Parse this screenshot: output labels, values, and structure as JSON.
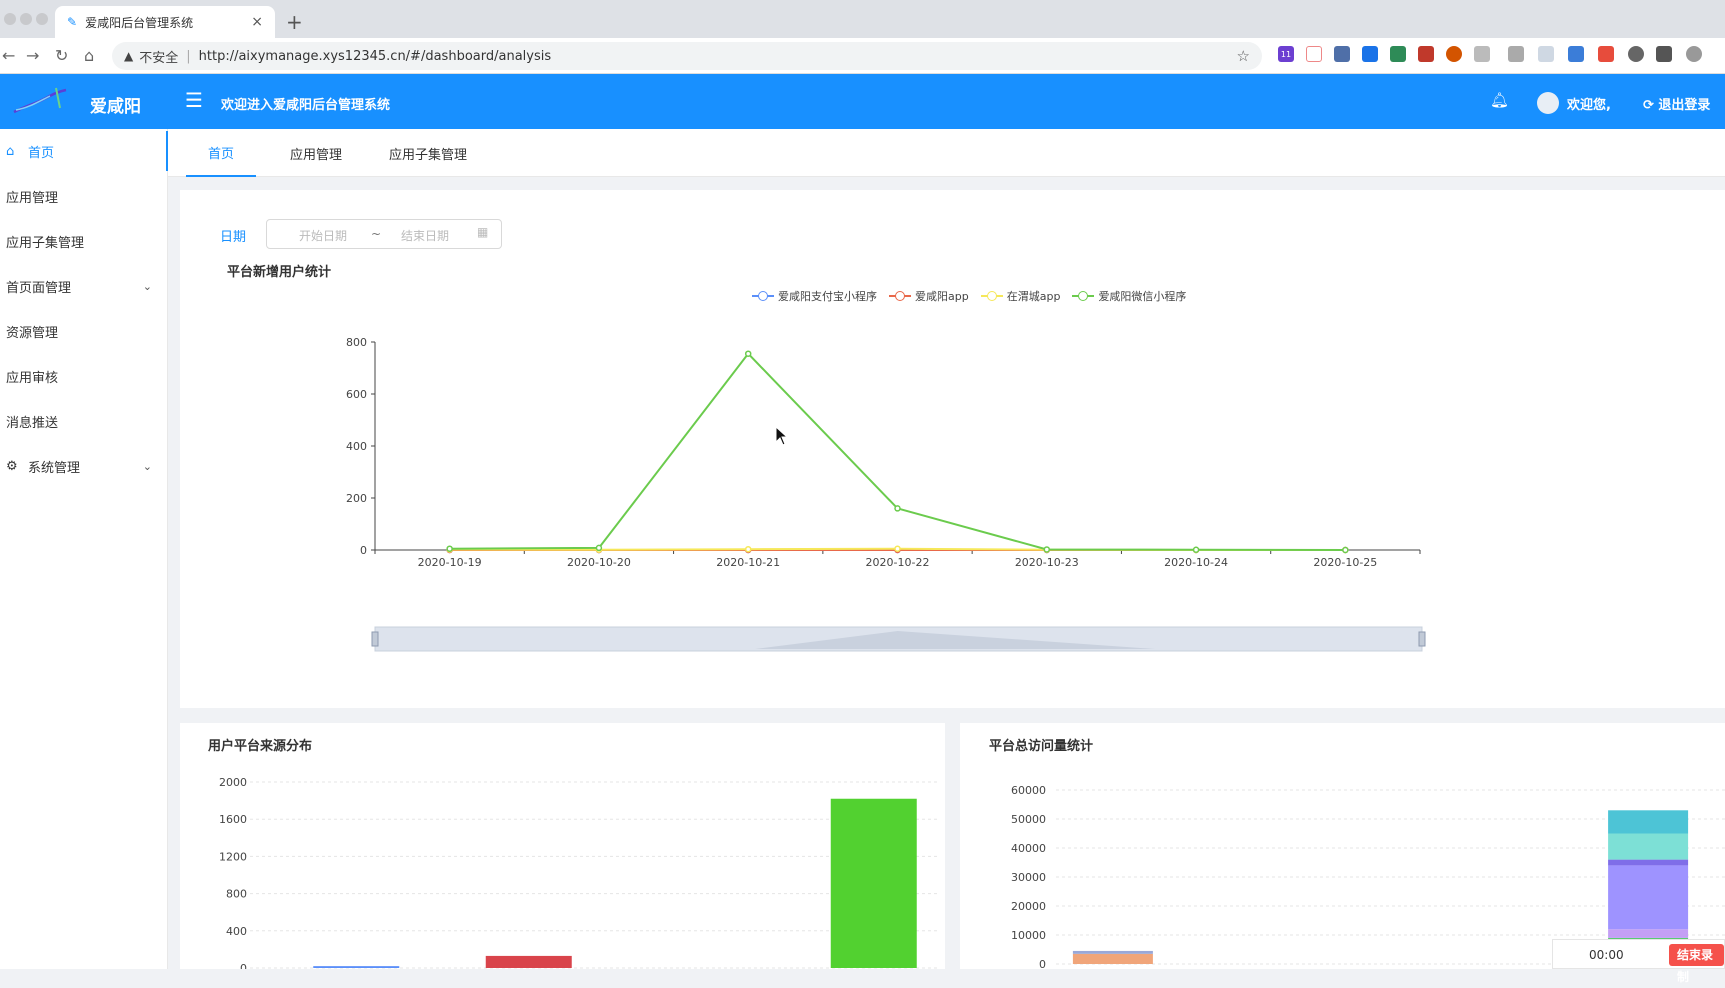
{
  "browser": {
    "tab_title": "爱咸阳后台管理系统",
    "close_glyph": "×",
    "new_tab_glyph": "+",
    "insecure_label": "不安全",
    "url": "http://aixymanage.xys12345.cn/#/dashboard/analysis",
    "ext_badge": "11"
  },
  "header": {
    "logo_text": "爱咸阳",
    "welcome_text": "欢迎进入爱咸阳后台管理系统",
    "user_greeting": "欢迎您,",
    "logout_label": "退出登录"
  },
  "sidebar": {
    "items": [
      {
        "label": "首页",
        "icon": "home-icon"
      },
      {
        "label": "应用管理"
      },
      {
        "label": "应用子集管理"
      },
      {
        "label": "首页面管理",
        "icon": "chevron-down-icon"
      },
      {
        "label": "资源管理"
      },
      {
        "label": "应用审核"
      },
      {
        "label": "消息推送"
      },
      {
        "label": "系统管理",
        "icon": "gear-icon"
      }
    ]
  },
  "tabs": [
    {
      "label": "首页"
    },
    {
      "label": "应用管理"
    },
    {
      "label": "应用子集管理"
    }
  ],
  "filter": {
    "date_label": "日期",
    "start_placeholder": "开始日期",
    "range_separator": "~",
    "end_placeholder": "结束日期"
  },
  "recorder": {
    "time": "00:00",
    "stop_label": "结束录制"
  },
  "chart_data": [
    {
      "type": "line",
      "title": "平台新增用户统计",
      "x": [
        "2020-10-19",
        "2020-10-20",
        "2020-10-21",
        "2020-10-22",
        "2020-10-23",
        "2020-10-24",
        "2020-10-25"
      ],
      "ylim": [
        0,
        800
      ],
      "yticks": [
        0,
        200,
        400,
        600,
        800
      ],
      "legend_position": "top-center",
      "series": [
        {
          "name": "爱咸阳支付宝小程序",
          "color": "#5b8ff9",
          "values": [
            0,
            0,
            0,
            0,
            0,
            0,
            0
          ]
        },
        {
          "name": "爱咸阳app",
          "color": "#e8684a",
          "values": [
            0,
            0,
            0,
            0,
            0,
            0,
            0
          ]
        },
        {
          "name": "在渭城app",
          "color": "#f6e85a",
          "values": [
            2,
            1,
            3,
            5,
            1,
            0,
            0
          ]
        },
        {
          "name": "爱咸阳微信小程序",
          "color": "#6bcb4d",
          "values": [
            5,
            8,
            755,
            160,
            2,
            1,
            0
          ]
        }
      ]
    },
    {
      "type": "bar",
      "title": "用户平台来源分布",
      "ylim": [
        0,
        2000
      ],
      "yticks": [
        0,
        400,
        800,
        1200,
        1600,
        2000
      ],
      "values": [
        20,
        130,
        0,
        1820
      ],
      "colors": [
        "#5b8ff9",
        "#d9444b",
        "#f6e85a",
        "#52d130"
      ],
      "grid": true
    },
    {
      "type": "bar",
      "title": "平台总访问量统计",
      "ylim": [
        0,
        60000
      ],
      "yticks": [
        0,
        10000,
        20000,
        30000,
        40000,
        50000,
        60000
      ],
      "stacked": true,
      "grid": true,
      "stacks": [
        [
          {
            "value": 3500,
            "color": "#f0a57a"
          },
          {
            "value": 1000,
            "color": "#9aa8d8"
          }
        ],
        [],
        [],
        [],
        [
          {
            "value": 9000,
            "color": "#5ac972"
          },
          {
            "value": 3000,
            "color": "#c49ff5"
          },
          {
            "value": 22000,
            "color": "#9e93ff"
          },
          {
            "value": 2000,
            "color": "#7f6ee8"
          },
          {
            "value": 9000,
            "color": "#7de0d6"
          },
          {
            "value": 8000,
            "color": "#4dc4d6"
          }
        ]
      ]
    }
  ]
}
